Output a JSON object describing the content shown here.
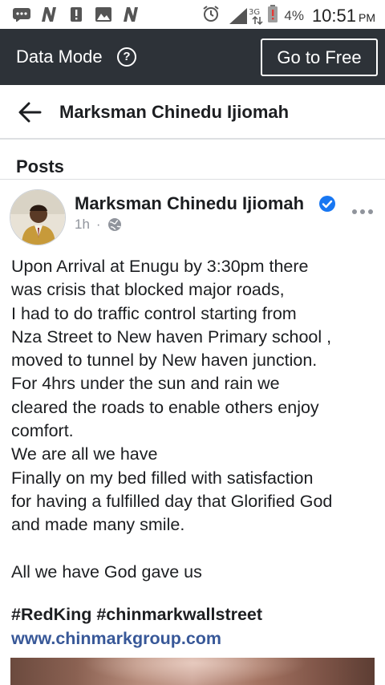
{
  "status_bar": {
    "battery_percent": "4%",
    "time": "10:51",
    "ampm": "PM",
    "network": "3G"
  },
  "data_mode_bar": {
    "label": "Data Mode",
    "button_label": "Go to Free"
  },
  "header": {
    "title": "Marksman Chinedu Ijiomah"
  },
  "section": {
    "heading": "Posts"
  },
  "post": {
    "author": "Marksman Chinedu Ijiomah",
    "time_ago": "1h",
    "meta_dot": "·",
    "body_lines": [
      "Upon Arrival at Enugu by 3:30pm there",
      "was crisis that blocked major roads,",
      "I had to do traffic control starting from",
      "Nza Street to New haven Primary school ,",
      " moved to tunnel by New haven junction.",
      "For 4hrs under the sun and rain we",
      "cleared the roads to enable others enjoy",
      "comfort.",
      "We are all we have",
      "Finally on my bed filled with satisfaction",
      "for having a fulfilled day that Glorified God",
      "and made many smile.",
      "",
      "All we have God gave us"
    ],
    "hashtags": "#RedKing #chinmarkwallstreet",
    "link": "www.chinmarkgroup.com"
  },
  "colors": {
    "data_bar_bg": "#2d3238",
    "link": "#385898",
    "verified": "#1877f2",
    "meta_gray": "#90949c",
    "divider": "#dddfe2"
  },
  "icons": {
    "back": "back-arrow-icon",
    "help": "help-circle-icon",
    "verified": "verified-badge-icon",
    "more": "more-options-icon",
    "privacy": "globe-icon"
  }
}
